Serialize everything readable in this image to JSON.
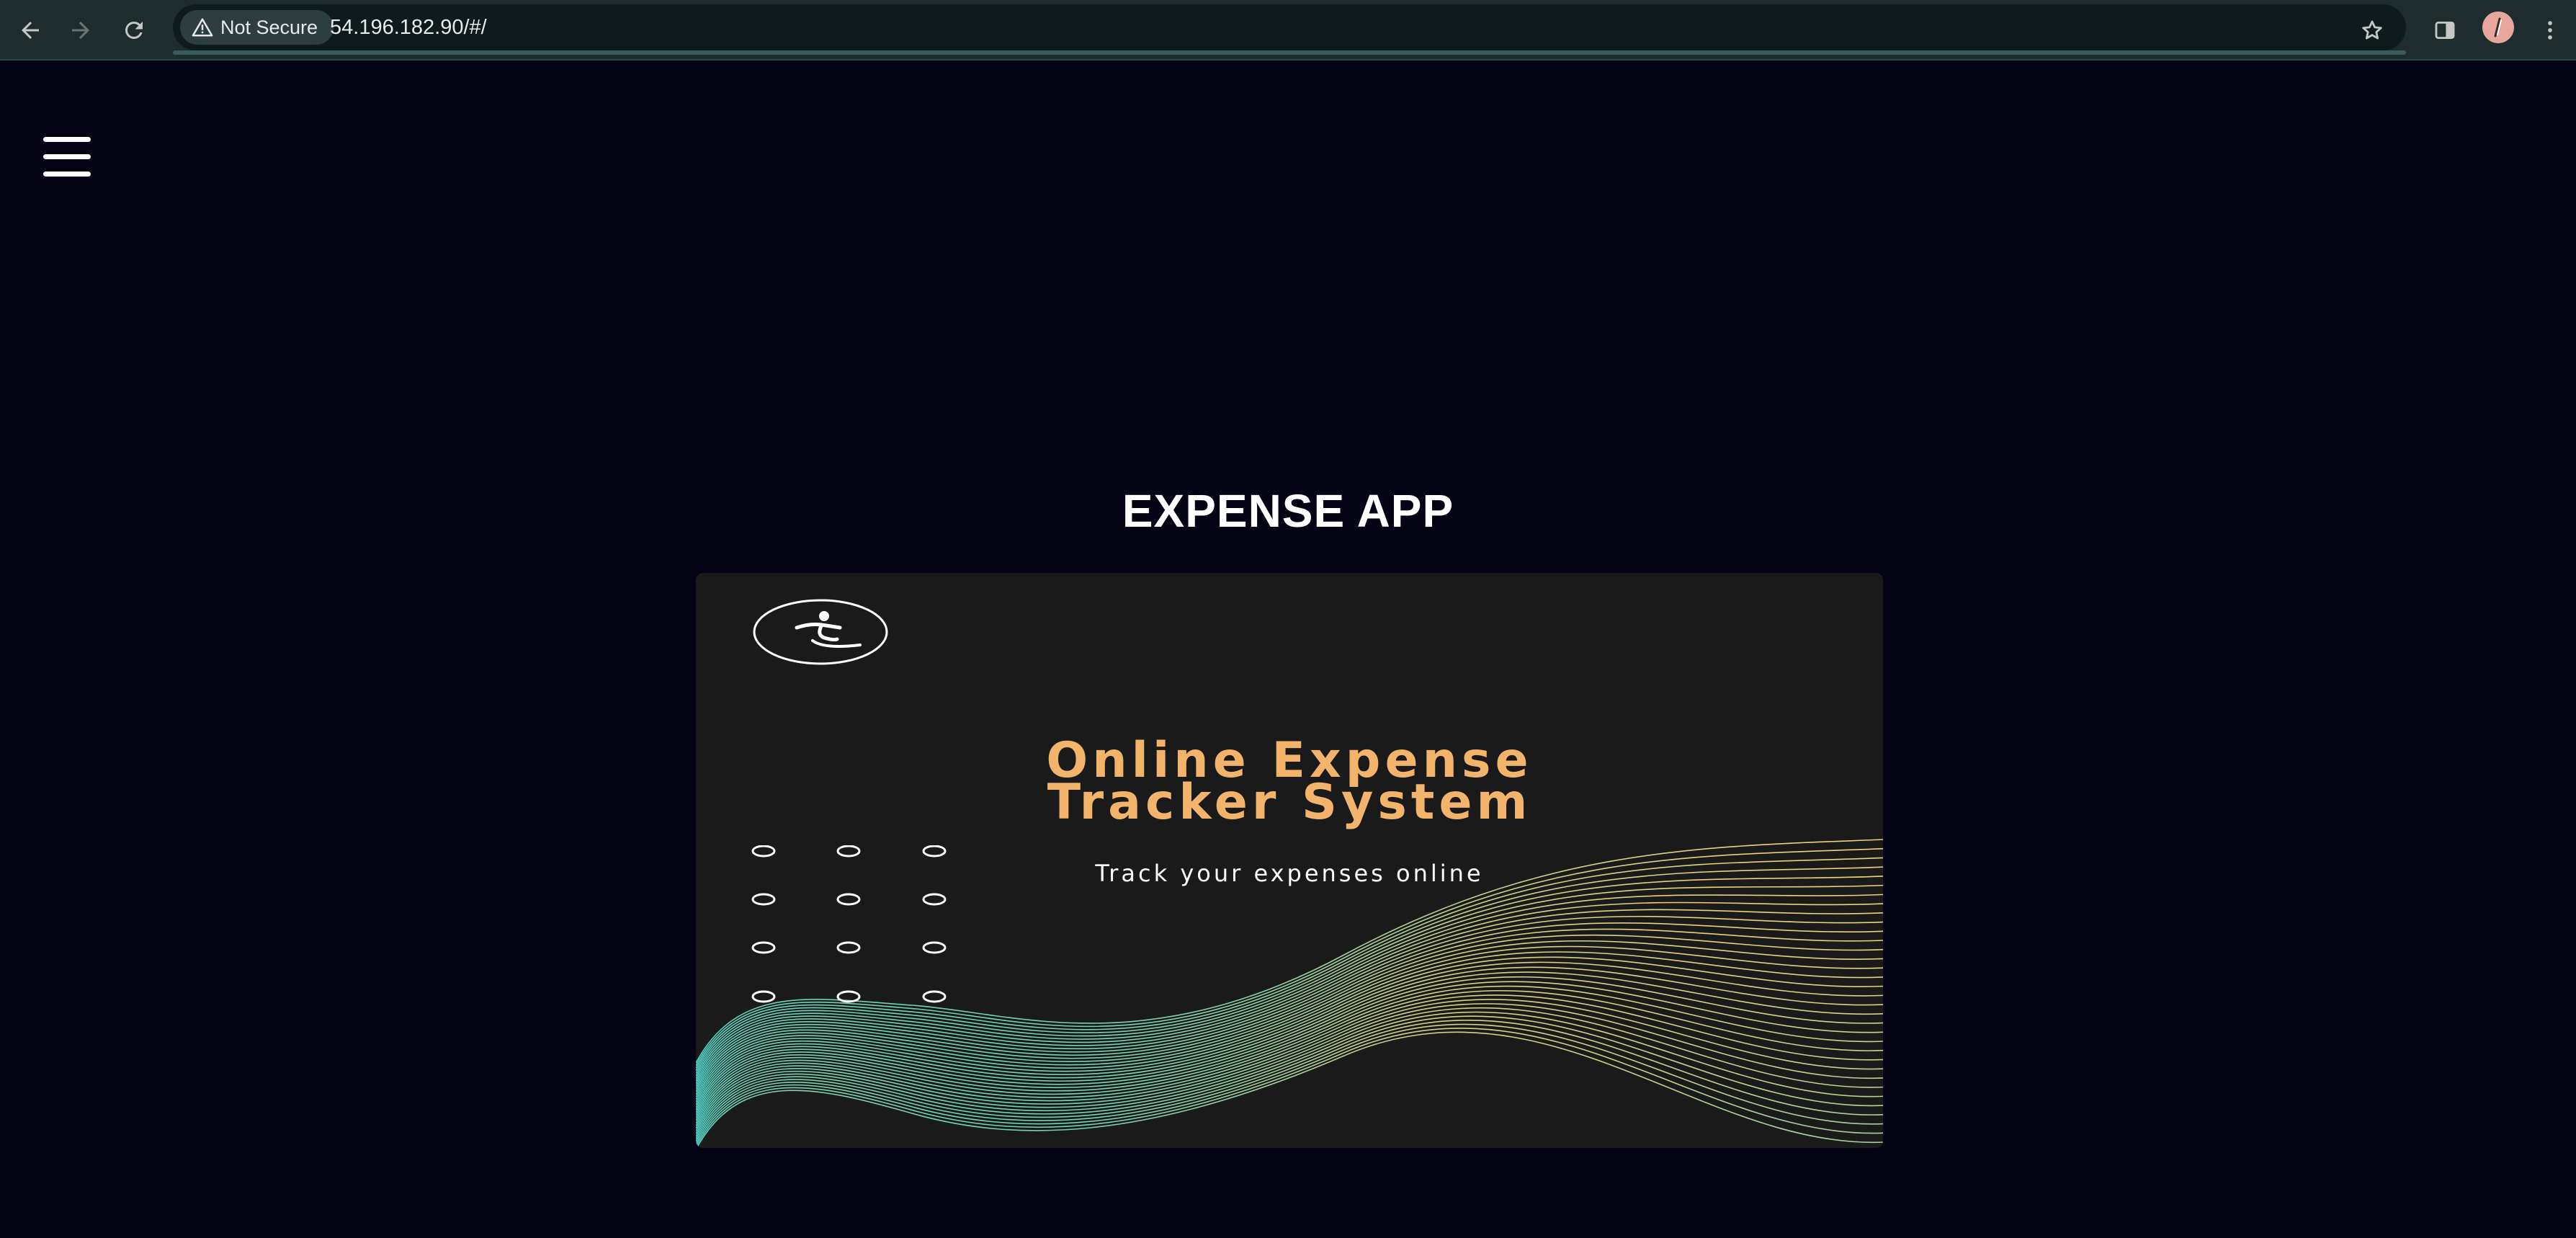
{
  "browser": {
    "security_label": "Not Secure",
    "url": "54.196.182.90/#/",
    "icons": {
      "back": "arrow-left-icon",
      "forward": "arrow-right-icon",
      "reload": "reload-icon",
      "warning": "warning-triangle-icon",
      "bookmark": "star-icon",
      "side_panel": "side-panel-icon",
      "menu": "kebab-menu-icon"
    }
  },
  "app": {
    "menu_icon": "hamburger-menu-icon",
    "title": "EXPENSE APP"
  },
  "banner": {
    "heading_line1": "Online Expense",
    "heading_line2": "Tracker System",
    "subtitle": "Track your expenses online",
    "colors": {
      "background": "#1a1a1a",
      "heading": "#f2b36a",
      "waves_start": "#4fd1c5",
      "waves_end": "#f2d27a"
    }
  },
  "colors": {
    "page_background": "#030314",
    "browser_bar": "#1f2c2e"
  }
}
